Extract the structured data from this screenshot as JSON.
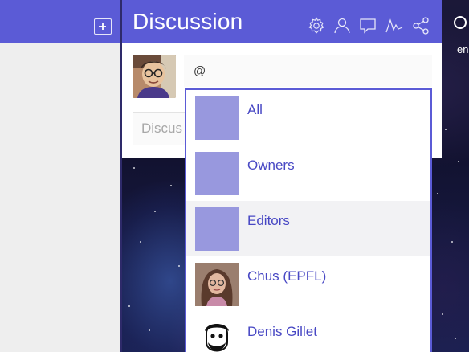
{
  "colors": {
    "header_bg": "#5b5bd6",
    "accent_text": "#4848c4",
    "group_thumb": "#9898de"
  },
  "left_panel": {
    "add_icon": "plus-square-icon"
  },
  "discussion": {
    "title": "Discussion",
    "header_icons": [
      "gear-icon",
      "user-icon",
      "comment-icon",
      "activity-icon",
      "share-icon"
    ],
    "comment_input_value": "@",
    "field_text": "Discus"
  },
  "right_strip": {
    "search_icon": "search-icon",
    "text": "en"
  },
  "mention_dropdown": {
    "items": [
      {
        "label": "All",
        "kind": "group"
      },
      {
        "label": "Owners",
        "kind": "group"
      },
      {
        "label": "Editors",
        "kind": "group",
        "highlighted": true
      },
      {
        "label": "Chus (EPFL)",
        "kind": "user"
      },
      {
        "label": "Denis Gillet",
        "kind": "user"
      }
    ]
  }
}
